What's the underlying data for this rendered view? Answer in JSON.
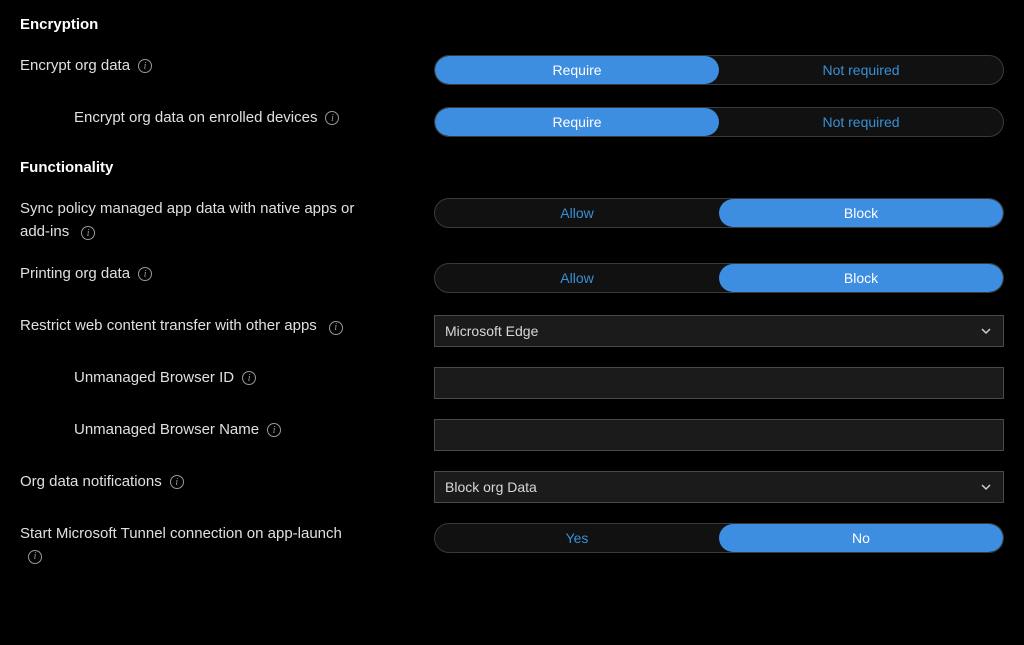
{
  "sections": {
    "encryption": {
      "title": "Encryption",
      "encryptOrgData": {
        "label": "Encrypt org data",
        "option1": "Require",
        "option2": "Not required",
        "selected": 0
      },
      "encryptOrgDataEnrolled": {
        "label": "Encrypt org data on enrolled devices",
        "option1": "Require",
        "option2": "Not required",
        "selected": 0
      }
    },
    "functionality": {
      "title": "Functionality",
      "syncPolicy": {
        "label": "Sync policy managed app data with native apps or add-ins",
        "option1": "Allow",
        "option2": "Block",
        "selected": 1
      },
      "printingOrgData": {
        "label": "Printing org data",
        "option1": "Allow",
        "option2": "Block",
        "selected": 1
      },
      "restrictWebContent": {
        "label": "Restrict web content transfer with other apps",
        "value": "Microsoft Edge"
      },
      "unmanagedBrowserId": {
        "label": "Unmanaged Browser ID",
        "value": ""
      },
      "unmanagedBrowserName": {
        "label": "Unmanaged Browser Name",
        "value": ""
      },
      "orgDataNotifications": {
        "label": "Org data notifications",
        "value": "Block org Data"
      },
      "startMicrosoftTunnel": {
        "label": "Start Microsoft Tunnel connection on app-launch",
        "option1": "Yes",
        "option2": "No",
        "selected": 1
      }
    }
  }
}
